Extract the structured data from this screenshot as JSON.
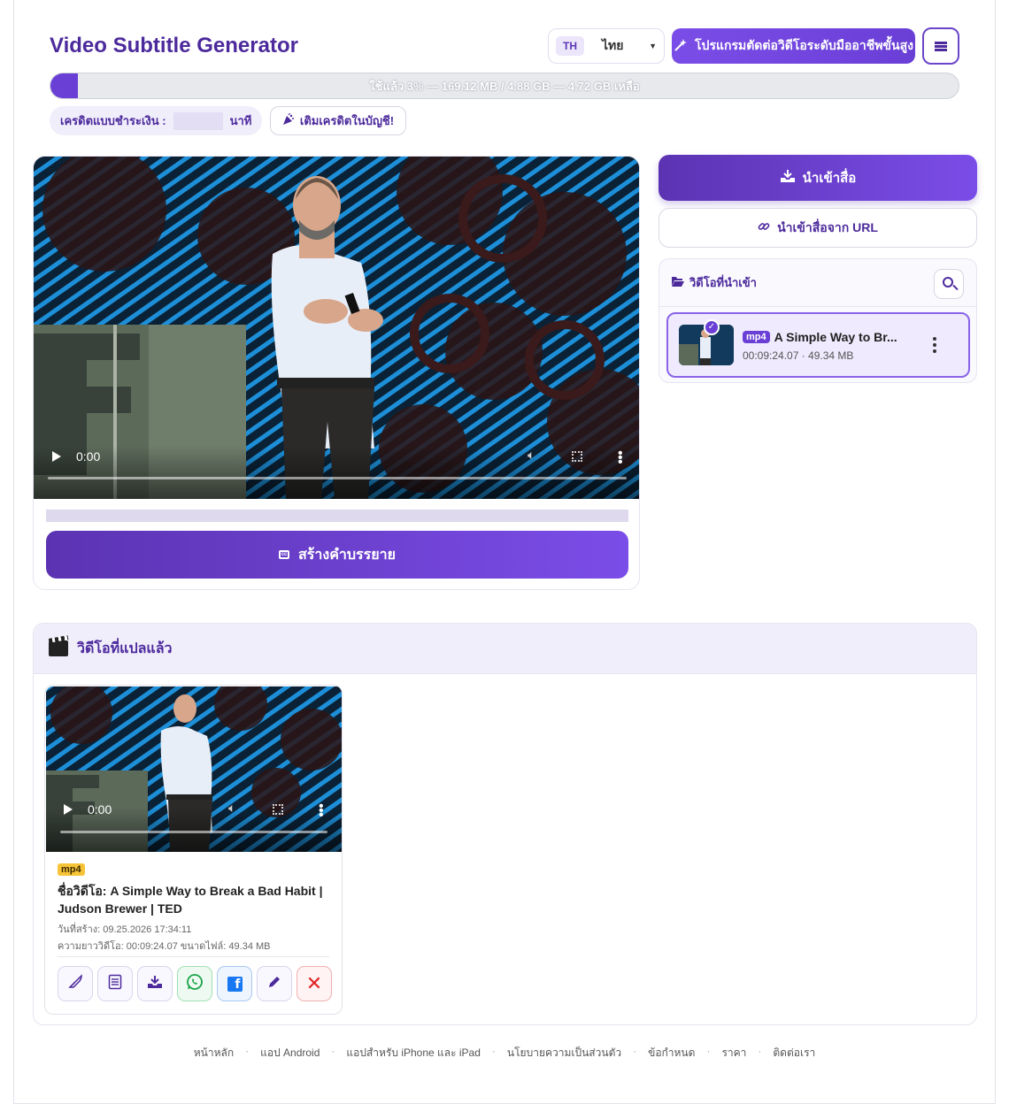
{
  "header": {
    "title": "Video Subtitle Generator",
    "language_code": "TH",
    "language_name": "ไทย",
    "promo_label": "โปรแกรมตัดต่อวิดีโอระดับมืออาชีพขั้นสูง"
  },
  "usage": {
    "percent": 3,
    "text": "ใช้แล้ว 3% — 169.12 MB / 4.88 GB — 4.72 GB เหลือ"
  },
  "credit": {
    "label": "เครดิตแบบชำระเงิน :",
    "unit": "นาที",
    "topup_label": "เติมเครดิตในบัญชี!"
  },
  "player": {
    "time": "0:00",
    "generate_label": "สร้างคำบรรยาย"
  },
  "import": {
    "import_label": "นำเข้าสื่อ",
    "url_label": "นำเข้าสื่อจาก URL",
    "library_title": "วิดีโอที่นำเข้า",
    "item": {
      "format": "mp4",
      "title": "A Simple Way to Br...",
      "meta": "00:09:24.07 · 49.34 MB"
    }
  },
  "translated": {
    "title": "วิดีโอที่แปลแล้ว",
    "card": {
      "time": "0:00",
      "format": "mp4",
      "title": "ชื่อวิดีโอ: A Simple Way to Break a Bad Habit | Judson Brewer | TED",
      "date": "วันที่สร้าง: 09.25.2026 17:34:11",
      "meta": "ความยาววิดีโอ: 00:09:24.07   ขนาดไฟล์: 49.34 MB"
    }
  },
  "footer": {
    "links": [
      "หน้าหลัก",
      "แอป Android",
      "แอปสำหรับ iPhone และ iPad",
      "นโยบายความเป็นส่วนตัว",
      "ข้อกำหนด",
      "ราคา",
      "ติดต่อเรา"
    ]
  },
  "colors": {
    "brand": "#4c2a9c",
    "accent": "#6a3fd6",
    "usage_track": "#e8e9ed"
  }
}
